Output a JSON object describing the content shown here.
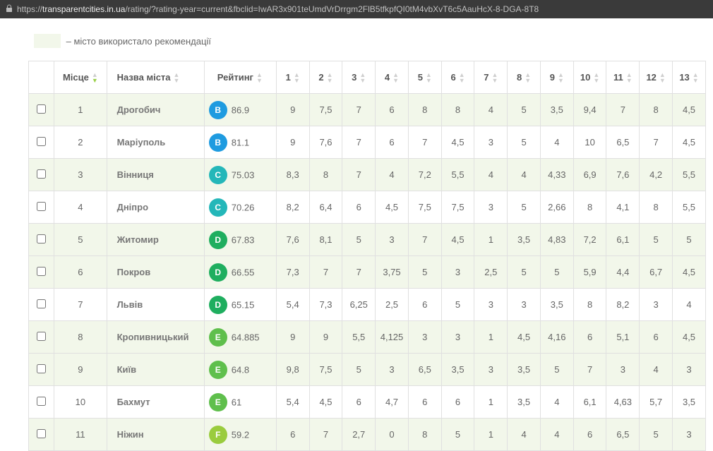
{
  "url": {
    "prefix": "https://",
    "domain": "transparentcities.in.ua",
    "path": "/rating/?rating-year=current&fbclid=IwAR3x901teUmdVrDrrgm2FlB5tfkpfQI0tM4vbXvT6c5AauHcX-8-DGA-8T8"
  },
  "legend_text": "– місто використало рекомендації",
  "columns": {
    "place": "Місце",
    "name": "Назва міста",
    "rating": "Рейтинг",
    "c1": "1",
    "c2": "2",
    "c3": "3",
    "c4": "4",
    "c5": "5",
    "c6": "6",
    "c7": "7",
    "c8": "8",
    "c9": "9",
    "c10": "10",
    "c11": "11",
    "c12": "12",
    "c13": "13"
  },
  "grade_colors": {
    "B": "#1e9be0",
    "C": "#24b7b9",
    "D": "#1fae5f",
    "E": "#5fbf4c",
    "F": "#9acc3e"
  },
  "chart_data": {
    "type": "table",
    "title": "City Transparency Rating",
    "columns": [
      "Місце",
      "Назва міста",
      "Рейтинг",
      "1",
      "2",
      "3",
      "4",
      "5",
      "6",
      "7",
      "8",
      "9",
      "10",
      "11",
      "12",
      "13"
    ]
  },
  "rows": [
    {
      "hi": true,
      "place": "1",
      "name": "Дрогобич",
      "grade": "B",
      "rating": "86.9",
      "v": [
        "9",
        "7,5",
        "7",
        "6",
        "8",
        "8",
        "4",
        "5",
        "3,5",
        "9,4",
        "7",
        "8",
        "4,5"
      ]
    },
    {
      "hi": false,
      "place": "2",
      "name": "Маріуполь",
      "grade": "B",
      "rating": "81.1",
      "v": [
        "9",
        "7,6",
        "7",
        "6",
        "7",
        "4,5",
        "3",
        "5",
        "4",
        "10",
        "6,5",
        "7",
        "4,5"
      ]
    },
    {
      "hi": true,
      "place": "3",
      "name": "Вінниця",
      "grade": "C",
      "rating": "75.03",
      "v": [
        "8,3",
        "8",
        "7",
        "4",
        "7,2",
        "5,5",
        "4",
        "4",
        "4,33",
        "6,9",
        "7,6",
        "4,2",
        "5,5"
      ]
    },
    {
      "hi": false,
      "place": "4",
      "name": "Дніпро",
      "grade": "C",
      "rating": "70.26",
      "v": [
        "8,2",
        "6,4",
        "6",
        "4,5",
        "7,5",
        "7,5",
        "3",
        "5",
        "2,66",
        "8",
        "4,1",
        "8",
        "5,5"
      ]
    },
    {
      "hi": true,
      "place": "5",
      "name": "Житомир",
      "grade": "D",
      "rating": "67.83",
      "v": [
        "7,6",
        "8,1",
        "5",
        "3",
        "7",
        "4,5",
        "1",
        "3,5",
        "4,83",
        "7,2",
        "6,1",
        "5",
        "5"
      ]
    },
    {
      "hi": true,
      "place": "6",
      "name": "Покров",
      "grade": "D",
      "rating": "66.55",
      "v": [
        "7,3",
        "7",
        "7",
        "3,75",
        "5",
        "3",
        "2,5",
        "5",
        "5",
        "5,9",
        "4,4",
        "6,7",
        "4,5"
      ]
    },
    {
      "hi": false,
      "place": "7",
      "name": "Львів",
      "grade": "D",
      "rating": "65.15",
      "v": [
        "5,4",
        "7,3",
        "6,25",
        "2,5",
        "6",
        "5",
        "3",
        "3",
        "3,5",
        "8",
        "8,2",
        "3",
        "4"
      ]
    },
    {
      "hi": true,
      "place": "8",
      "name": "Кропивницький",
      "grade": "E",
      "rating": "64.885",
      "v": [
        "9",
        "9",
        "5,5",
        "4,125",
        "3",
        "3",
        "1",
        "4,5",
        "4,16",
        "6",
        "5,1",
        "6",
        "4,5"
      ]
    },
    {
      "hi": true,
      "place": "9",
      "name": "Київ",
      "grade": "E",
      "rating": "64.8",
      "v": [
        "9,8",
        "7,5",
        "5",
        "3",
        "6,5",
        "3,5",
        "3",
        "3,5",
        "5",
        "7",
        "3",
        "4",
        "3"
      ]
    },
    {
      "hi": false,
      "place": "10",
      "name": "Бахмут",
      "grade": "E",
      "rating": "61",
      "v": [
        "5,4",
        "4,5",
        "6",
        "4,7",
        "6",
        "6",
        "1",
        "3,5",
        "4",
        "6,1",
        "4,63",
        "5,7",
        "3,5"
      ]
    },
    {
      "hi": true,
      "place": "11",
      "name": "Ніжин",
      "grade": "F",
      "rating": "59.2",
      "v": [
        "6",
        "7",
        "2,7",
        "0",
        "8",
        "5",
        "1",
        "4",
        "4",
        "6",
        "6,5",
        "5",
        "3"
      ]
    }
  ]
}
